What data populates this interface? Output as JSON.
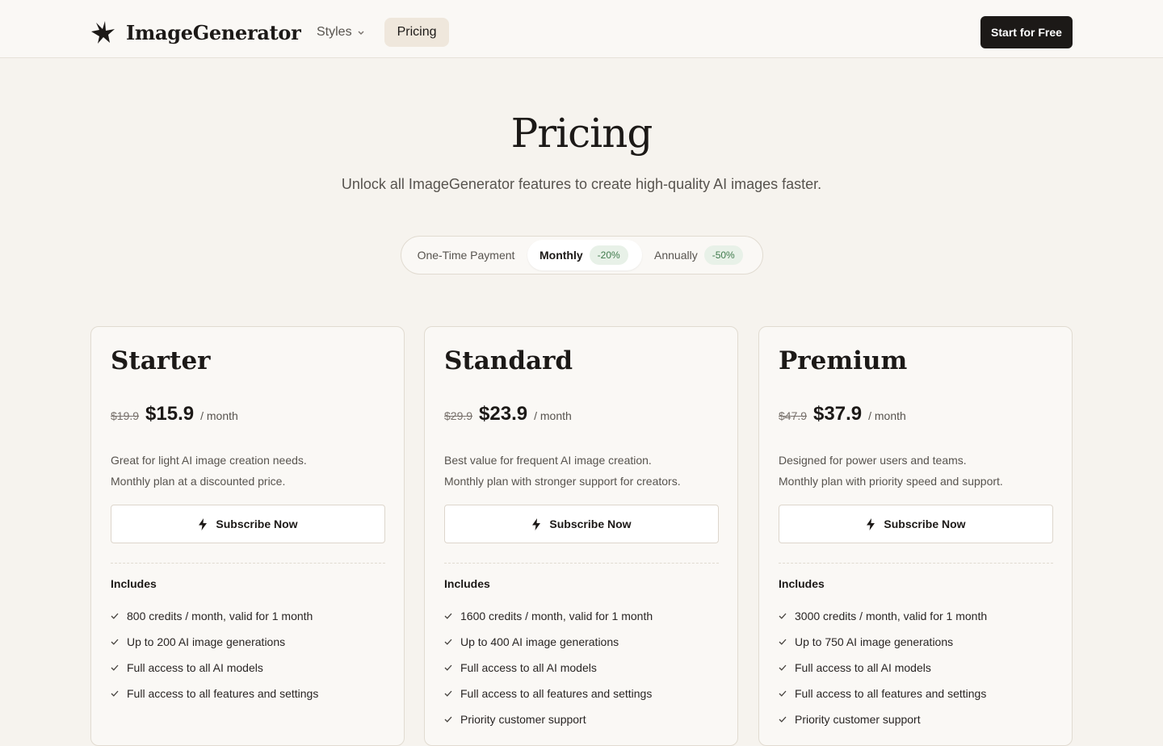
{
  "header": {
    "brand": "ImageGenerator",
    "nav": [
      {
        "label": "Styles",
        "has_dropdown": true,
        "active": false
      },
      {
        "label": "Pricing",
        "has_dropdown": false,
        "active": true
      }
    ],
    "cta": "Start for Free"
  },
  "hero": {
    "title": "Pricing",
    "subtitle": "Unlock all ImageGenerator features to create high-quality AI images faster."
  },
  "billing": {
    "options": [
      {
        "label": "One-Time Payment",
        "badge": "",
        "selected": false
      },
      {
        "label": "Monthly",
        "badge": "-20%",
        "selected": true
      },
      {
        "label": "Annually",
        "badge": "-50%",
        "selected": false
      }
    ]
  },
  "plans": [
    {
      "name": "Starter",
      "old_price": "$19.9",
      "price": "$15.9",
      "period": "/ month",
      "desc1": "Great for light AI image creation needs.",
      "desc2": "Monthly plan at a discounted price.",
      "button": "Subscribe Now",
      "includes": "Includes",
      "features": [
        "800 credits / month, valid for 1 month",
        "Up to 200 AI image generations",
        "Full access to all AI models",
        "Full access to all features and settings"
      ]
    },
    {
      "name": "Standard",
      "old_price": "$29.9",
      "price": "$23.9",
      "period": "/ month",
      "desc1": "Best value for frequent AI image creation.",
      "desc2": "Monthly plan with stronger support for creators.",
      "button": "Subscribe Now",
      "includes": "Includes",
      "features": [
        "1600 credits / month, valid for 1 month",
        "Up to 400 AI image generations",
        "Full access to all AI models",
        "Full access to all features and settings",
        "Priority customer support"
      ]
    },
    {
      "name": "Premium",
      "old_price": "$47.9",
      "price": "$37.9",
      "period": "/ month",
      "desc1": "Designed for power users and teams.",
      "desc2": "Monthly plan with priority speed and support.",
      "button": "Subscribe Now",
      "includes": "Includes",
      "features": [
        "3000 credits / month, valid for 1 month",
        "Up to 750 AI image generations",
        "Full access to all AI models",
        "Full access to all features and settings",
        "Priority customer support"
      ]
    }
  ],
  "icons": {
    "logo": "bird-logo-icon",
    "nav_dropdown": "chevron-down-icon",
    "subscribe": "lightning-bolt-icon",
    "feature": "check-icon"
  },
  "colors": {
    "page_bg": "#f6f3ee",
    "header_bg": "#faf8f5",
    "primary_button": "#1c1917",
    "active_nav_bg": "#efe7dc",
    "discount_badge_bg": "#e8f1e8",
    "discount_badge_text": "#3f7a4c"
  }
}
